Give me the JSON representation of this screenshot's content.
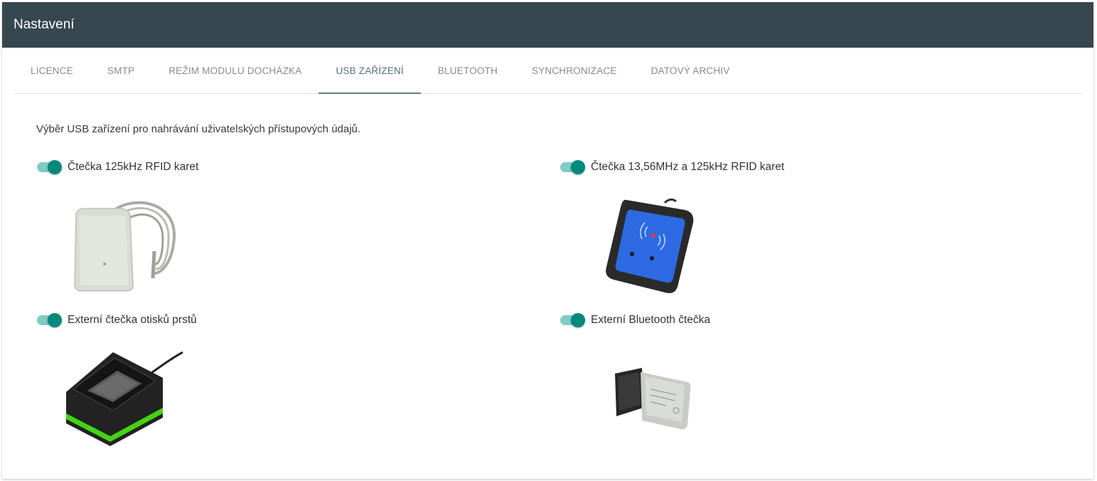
{
  "header": {
    "title": "Nastavení"
  },
  "tabs": [
    {
      "label": "LICENCE"
    },
    {
      "label": "SMTP"
    },
    {
      "label": "REŽIM MODULU DOCHÁZKA"
    },
    {
      "label": "USB ZAŘÍZENÍ",
      "active": true
    },
    {
      "label": "BLUETOOTH"
    },
    {
      "label": "SYNCHRONIZACE"
    },
    {
      "label": "DATOVÝ ARCHIV"
    }
  ],
  "intro": "Výběr USB zařízení pro nahrávání uživatelských přístupových údajů.",
  "devices": [
    {
      "label": "Čtečka 125kHz RFID karet",
      "enabled": true,
      "icon": "rfid-125khz-reader-icon"
    },
    {
      "label": "Čtečka 13,56MHz a 125kHz RFID karet",
      "enabled": true,
      "icon": "rfid-dual-reader-icon"
    },
    {
      "label": "Externí čtečka otisků prstů",
      "enabled": true,
      "icon": "fingerprint-reader-icon"
    },
    {
      "label": "Externí Bluetooth čtečka",
      "enabled": true,
      "icon": "bluetooth-dongle-icon"
    }
  ],
  "colors": {
    "header_bg": "#37474f",
    "accent": "#00897b",
    "accent_light": "#80cbc4"
  }
}
